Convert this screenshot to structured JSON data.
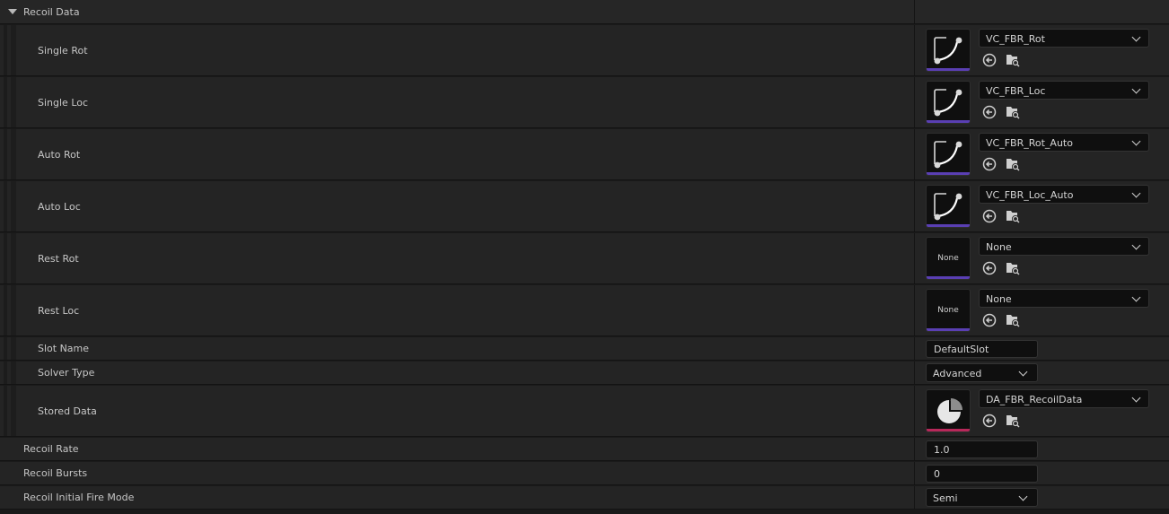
{
  "section": {
    "title": "Recoil Data"
  },
  "curves": [
    {
      "label": "Single Rot",
      "asset": "VC_FBR_Rot",
      "thumbnail": "curve-icon"
    },
    {
      "label": "Single Loc",
      "asset": "VC_FBR_Loc",
      "thumbnail": "curve-icon"
    },
    {
      "label": "Auto Rot",
      "asset": "VC_FBR_Rot_Auto",
      "thumbnail": "curve-icon"
    },
    {
      "label": "Auto Loc",
      "asset": "VC_FBR_Loc_Auto",
      "thumbnail": "curve-icon"
    },
    {
      "label": "Rest Rot",
      "asset": "None",
      "thumbnail_text": "None"
    },
    {
      "label": "Rest Loc",
      "asset": "None",
      "thumbnail_text": "None"
    }
  ],
  "slot_name": {
    "label": "Slot Name",
    "value": "DefaultSlot"
  },
  "solver_type": {
    "label": "Solver Type",
    "value": "Advanced"
  },
  "stored_data": {
    "label": "Stored Data",
    "asset": "DA_FBR_RecoilData",
    "thumbnail": "pie-chart-icon"
  },
  "recoil_rate": {
    "label": "Recoil Rate",
    "value": "1.0"
  },
  "recoil_bursts": {
    "label": "Recoil Bursts",
    "value": "0"
  },
  "fire_mode": {
    "label": "Recoil Initial Fire Mode",
    "value": "Semi"
  },
  "colors": {
    "curve_accent": "#5a3fb3",
    "data_asset_accent": "#b8285a",
    "panel_bg": "#242424",
    "field_bg": "#0f0f0f"
  }
}
